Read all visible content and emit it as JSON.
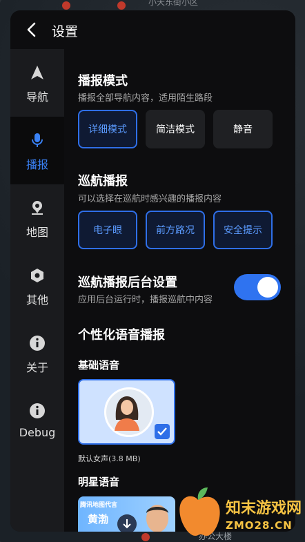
{
  "map": {
    "top_label": "小天东街小区",
    "bottom_label": "办公大楼"
  },
  "header": {
    "title": "设置"
  },
  "sidebar": {
    "items": [
      {
        "label": "导航",
        "icon": "navigation-arrow-icon"
      },
      {
        "label": "播报",
        "icon": "microphone-icon"
      },
      {
        "label": "地图",
        "icon": "map-pin-icon"
      },
      {
        "label": "其他",
        "icon": "hexagon-icon"
      },
      {
        "label": "关于",
        "icon": "info-icon"
      },
      {
        "label": "Debug",
        "icon": "info-icon"
      }
    ],
    "active_index": 1
  },
  "broadcast_mode": {
    "title": "播报模式",
    "desc": "播报全部导航内容，适用陌生路段",
    "options": [
      "详细模式",
      "简洁模式",
      "静音"
    ],
    "selected": "详细模式"
  },
  "cruise": {
    "title": "巡航播报",
    "desc": "可以选择在巡航时感兴趣的播报内容",
    "options": [
      "电子眼",
      "前方路况",
      "安全提示"
    ]
  },
  "cruise_bg": {
    "title": "巡航播报后台设置",
    "desc": "应用后台运行时，播报巡航中内容",
    "enabled": true
  },
  "voice": {
    "title": "个性化语音播报",
    "basic_title": "基础语音",
    "basic_caption": "默认女声(3.8 MB)",
    "star_title": "明星语音",
    "star_card_caption": "腾讯地图代言",
    "star_name": "黄渤"
  },
  "watermark": {
    "title": "知末游戏网",
    "sub": "ZMO28.CN"
  },
  "colors": {
    "accent": "#2f6fe8",
    "panel": "#0d0d0f",
    "sidebar": "#1a1b1e"
  }
}
